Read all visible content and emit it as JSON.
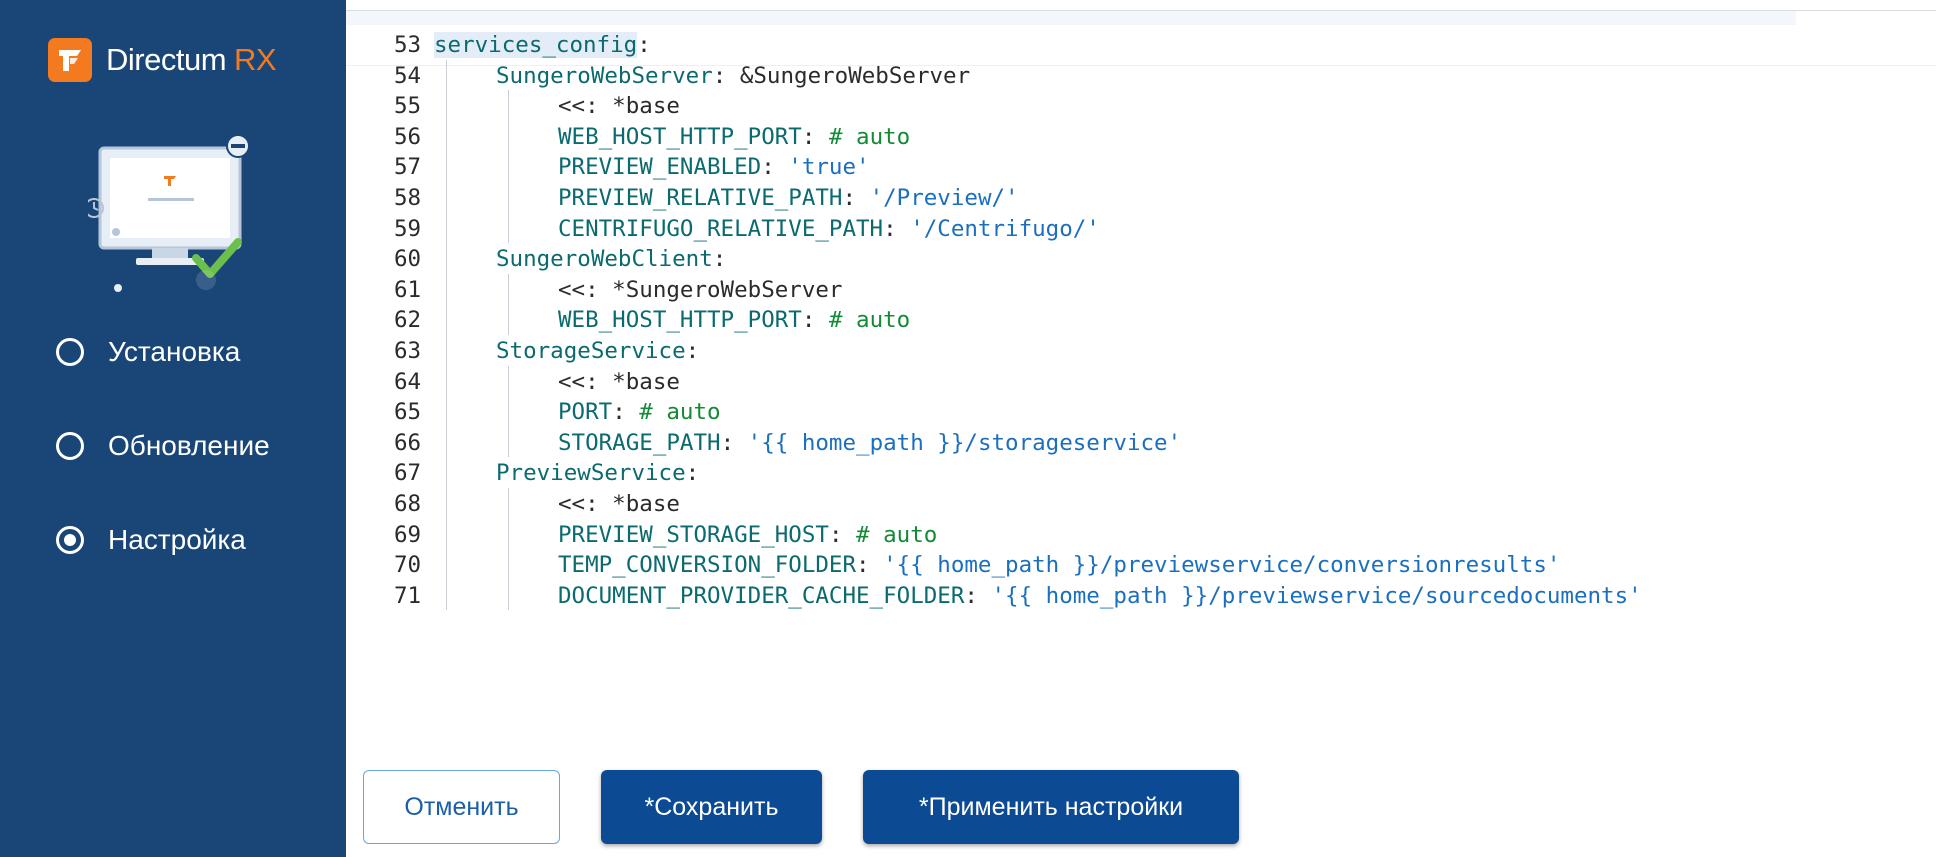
{
  "app": {
    "name": "Directum",
    "name_accent": "RX"
  },
  "nav": {
    "items": [
      {
        "label": "Установка",
        "selected": false
      },
      {
        "label": "Обновление",
        "selected": false
      },
      {
        "label": "Настройка",
        "selected": true
      }
    ]
  },
  "editor": {
    "current_line_marker": "x",
    "lines": [
      {
        "n": "53",
        "indent": 0,
        "parts": [
          {
            "t": "services_config",
            "c": "k",
            "sel": true
          },
          {
            "t": ":",
            "c": "p"
          }
        ]
      },
      {
        "n": "54",
        "indent": 1,
        "parts": [
          {
            "t": "SungeroWebServer",
            "c": "k"
          },
          {
            "t": ": &SungeroWebServer",
            "c": "p"
          }
        ]
      },
      {
        "n": "55",
        "indent": 2,
        "parts": [
          {
            "t": "<<: *base",
            "c": "p"
          }
        ]
      },
      {
        "n": "56",
        "indent": 2,
        "parts": [
          {
            "t": "WEB_HOST_HTTP_PORT",
            "c": "k"
          },
          {
            "t": ": ",
            "c": "p"
          },
          {
            "t": "# auto",
            "c": "c"
          }
        ]
      },
      {
        "n": "57",
        "indent": 2,
        "parts": [
          {
            "t": "PREVIEW_ENABLED",
            "c": "k"
          },
          {
            "t": ": ",
            "c": "p"
          },
          {
            "t": "'true'",
            "c": "s"
          }
        ]
      },
      {
        "n": "58",
        "indent": 2,
        "parts": [
          {
            "t": "PREVIEW_RELATIVE_PATH",
            "c": "k"
          },
          {
            "t": ": ",
            "c": "p"
          },
          {
            "t": "'/Preview/'",
            "c": "s"
          }
        ]
      },
      {
        "n": "59",
        "indent": 2,
        "parts": [
          {
            "t": "CENTRIFUGO_RELATIVE_PATH",
            "c": "k"
          },
          {
            "t": ": ",
            "c": "p"
          },
          {
            "t": "'/Centrifugo/'",
            "c": "s"
          }
        ]
      },
      {
        "n": "60",
        "indent": 1,
        "parts": [
          {
            "t": "SungeroWebClient",
            "c": "k"
          },
          {
            "t": ":",
            "c": "p"
          }
        ]
      },
      {
        "n": "61",
        "indent": 2,
        "parts": [
          {
            "t": "<<: *SungeroWebServer",
            "c": "p"
          }
        ]
      },
      {
        "n": "62",
        "indent": 2,
        "parts": [
          {
            "t": "WEB_HOST_HTTP_PORT",
            "c": "k"
          },
          {
            "t": ": ",
            "c": "p"
          },
          {
            "t": "# auto",
            "c": "c"
          }
        ]
      },
      {
        "n": "63",
        "indent": 1,
        "parts": [
          {
            "t": "StorageService",
            "c": "k"
          },
          {
            "t": ":",
            "c": "p"
          }
        ]
      },
      {
        "n": "64",
        "indent": 2,
        "parts": [
          {
            "t": "<<: *base",
            "c": "p"
          }
        ]
      },
      {
        "n": "65",
        "indent": 2,
        "parts": [
          {
            "t": "PORT",
            "c": "k"
          },
          {
            "t": ": ",
            "c": "p"
          },
          {
            "t": "# auto",
            "c": "c"
          }
        ]
      },
      {
        "n": "66",
        "indent": 2,
        "parts": [
          {
            "t": "STORAGE_PATH",
            "c": "k"
          },
          {
            "t": ": ",
            "c": "p"
          },
          {
            "t": "'{{ home_path }}/storageservice'",
            "c": "s"
          }
        ]
      },
      {
        "n": "67",
        "indent": 1,
        "parts": [
          {
            "t": "PreviewService",
            "c": "k"
          },
          {
            "t": ":",
            "c": "p"
          }
        ]
      },
      {
        "n": "68",
        "indent": 2,
        "parts": [
          {
            "t": "<<: *base",
            "c": "p"
          }
        ]
      },
      {
        "n": "69",
        "indent": 2,
        "parts": [
          {
            "t": "PREVIEW_STORAGE_HOST",
            "c": "k"
          },
          {
            "t": ": ",
            "c": "p"
          },
          {
            "t": "# auto",
            "c": "c"
          }
        ]
      },
      {
        "n": "70",
        "indent": 2,
        "parts": [
          {
            "t": "TEMP_CONVERSION_FOLDER",
            "c": "k"
          },
          {
            "t": ": ",
            "c": "p"
          },
          {
            "t": "'{{ home_path }}/previewservice/conversionresults'",
            "c": "s"
          }
        ]
      },
      {
        "n": "71",
        "indent": 2,
        "parts": [
          {
            "t": "DOCUMENT_PROVIDER_CACHE_FOLDER",
            "c": "k"
          },
          {
            "t": ": ",
            "c": "p"
          },
          {
            "t": "'{{ home_path }}/previewservice/sourcedocuments'",
            "c": "s"
          }
        ]
      }
    ]
  },
  "actions": {
    "cancel_label": "Отменить",
    "save_label": "*Сохранить",
    "apply_label": "*Применить настройки"
  },
  "colors": {
    "sidebar_bg": "#1a4677",
    "brand_orange": "#f47a20",
    "primary_button": "#0c4a93",
    "yaml_key": "#0b6a6e",
    "yaml_string": "#1b6fbf",
    "yaml_comment": "#138a36"
  },
  "icons": [
    "directum-logo-icon",
    "workstation-illustration-icon",
    "radio-icon",
    "radio-checked-icon"
  ]
}
